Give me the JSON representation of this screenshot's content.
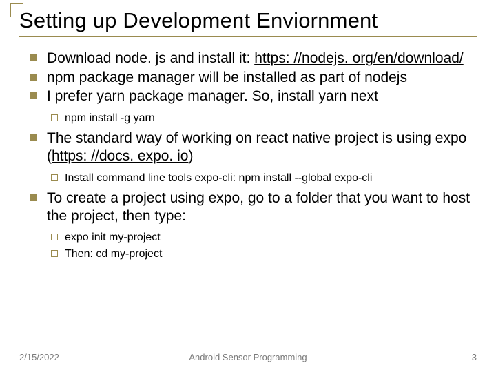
{
  "title": "Setting up Development Enviornment",
  "bullets": {
    "b0_a": "Download node. js and install it: ",
    "b0_link": "https: //nodejs. org/en/download/",
    "b1": "npm package manager will be installed as part of nodejs",
    "b2": "I prefer yarn package manager. So, install yarn next",
    "b2_sub0": "npm install -g yarn",
    "b3_a": "The standard way of working on react native project is using expo (",
    "b3_link": "https: //docs. expo. io",
    "b3_b": ")",
    "b3_sub0": "Install command line tools expo-cli: npm install --global expo-cli",
    "b4": "To create a project using expo, go to a folder that you want to host the project, then type:",
    "b4_sub0": "expo init my-project",
    "b4_sub1": "Then: cd my-project"
  },
  "footer": {
    "date": "2/15/2022",
    "center": "Android Sensor Programming",
    "page": "3"
  }
}
